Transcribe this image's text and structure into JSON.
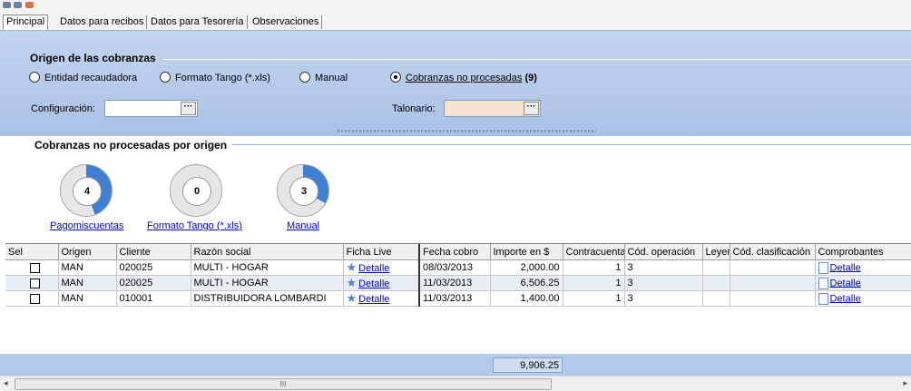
{
  "tabs": [
    {
      "label": "Principal",
      "active": true
    },
    {
      "label": "Datos para recibos",
      "active": false
    },
    {
      "label": "Datos para Tesorería",
      "active": false
    },
    {
      "label": "Observaciones",
      "active": false
    }
  ],
  "origen": {
    "title": "Origen de las cobranzas",
    "options": [
      {
        "label": "Entidad recaudadora",
        "selected": false
      },
      {
        "label": "Formato Tango (*.xls)",
        "selected": false
      },
      {
        "label": "Manual",
        "selected": false
      },
      {
        "label": "Cobranzas no procesadas",
        "selected": true,
        "count": "(9)"
      }
    ],
    "configuracion_label": "Configuración:",
    "talonario_label": "Talonario:",
    "picker_button": "···"
  },
  "stats": {
    "title": "Cobranzas no procesadas por origen",
    "items": [
      {
        "label": "Pagomiscuentas",
        "count": "4",
        "fraction": 0.444
      },
      {
        "label": "Formato Tango (*.xls)",
        "count": "0",
        "fraction": 0
      },
      {
        "label": "Manual",
        "count": "3",
        "fraction": 0.333
      }
    ]
  },
  "grid": {
    "columns": [
      "Sel",
      "Origen",
      "Cliente",
      "Razón social",
      "Ficha Live",
      "Fecha cobro",
      "Importe en $",
      "Contracuenta",
      "Cód. operación",
      "Leyen",
      "Cód. clasificación",
      "Comprobantes"
    ],
    "rows": [
      {
        "origen": "MAN",
        "cliente": "020025",
        "razon": "MULTI - HOGAR",
        "ficha": "Detalle",
        "fecha": "08/03/2013",
        "importe": "2,000.00",
        "contra": "1",
        "codop": "3",
        "leyenda": "",
        "codclas": "",
        "comp": "Detalle"
      },
      {
        "origen": "MAN",
        "cliente": "020025",
        "razon": "MULTI - HOGAR",
        "ficha": "Detalle",
        "fecha": "11/03/2013",
        "importe": "6,506.25",
        "contra": "1",
        "codop": "3",
        "leyenda": "",
        "codclas": "",
        "comp": "Detalle"
      },
      {
        "origen": "MAN",
        "cliente": "010001",
        "razon": "DISTRIBUIDORA LOMBARDI",
        "ficha": "Detalle",
        "fecha": "11/03/2013",
        "importe": "1,400.00",
        "contra": "1",
        "codop": "3",
        "leyenda": "",
        "codclas": "",
        "comp": "Detalle"
      }
    ],
    "total": "9,906.25"
  },
  "scroll": {
    "thumb_glyph": "III"
  },
  "colors": {
    "ring_fill": "#3f7fd4",
    "ring_track": "#e6e6e6"
  }
}
